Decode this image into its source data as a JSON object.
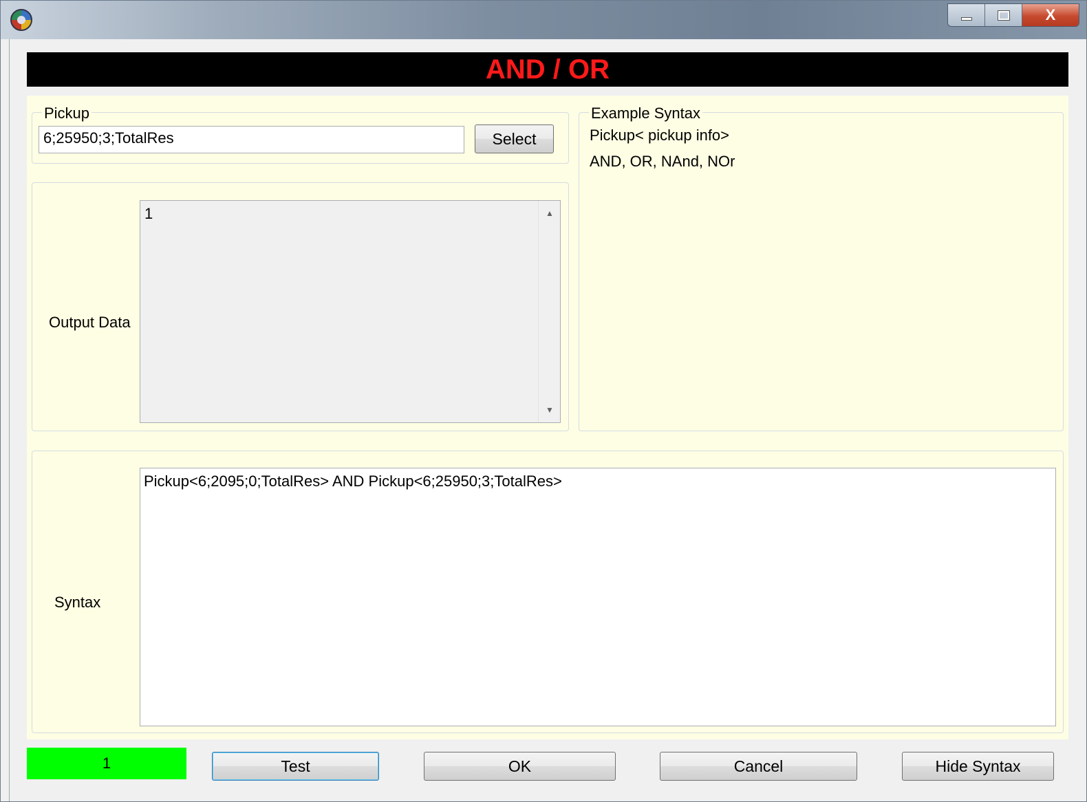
{
  "window": {
    "title": "",
    "controls": {
      "minimize": "minimize",
      "maximize": "maximize",
      "close": "X"
    }
  },
  "header": {
    "title": "AND / OR",
    "title_color": "#ff1a1a",
    "background": "#000000"
  },
  "pickup": {
    "legend": "Pickup",
    "value": "6;25950;3;TotalRes",
    "select_label": "Select"
  },
  "output": {
    "label": "Output Data",
    "value": "1"
  },
  "example": {
    "legend": "Example Syntax",
    "line1": "Pickup< pickup info>",
    "line2": "AND, OR, NAnd, NOr"
  },
  "syntax": {
    "label": "Syntax",
    "value": "Pickup<6;2095;0;TotalRes> AND Pickup<6;25950;3;TotalRes>"
  },
  "footer": {
    "status_value": "1",
    "status_color": "#00ff00",
    "test_label": "Test",
    "ok_label": "OK",
    "cancel_label": "Cancel",
    "hide_syntax_label": "Hide Syntax"
  },
  "icons": {
    "app": "app-icon",
    "scroll_up": "scroll-up-arrow-icon",
    "scroll_down": "scroll-down-arrow-icon"
  }
}
